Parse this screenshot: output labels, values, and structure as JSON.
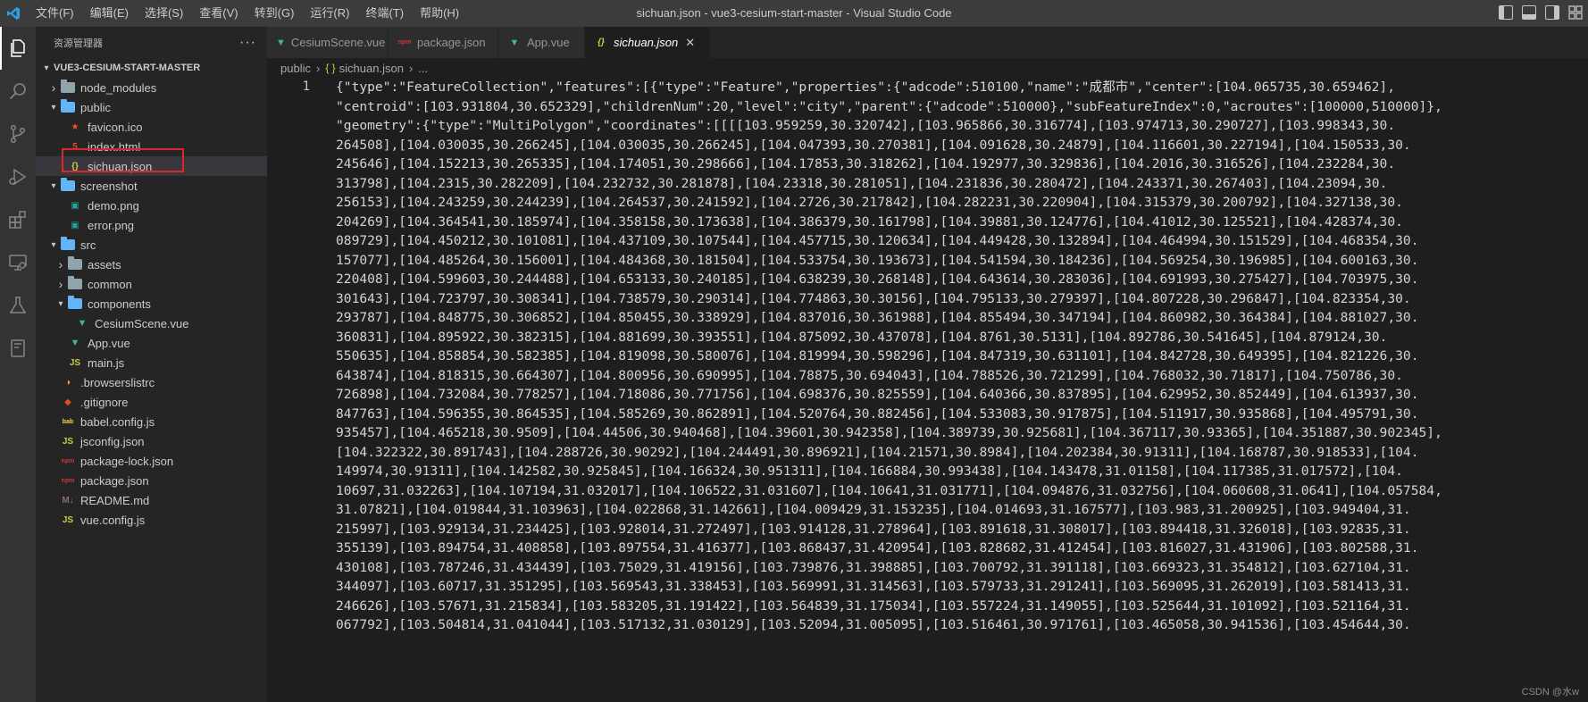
{
  "titlebar": {
    "menu": [
      "文件(F)",
      "编辑(E)",
      "选择(S)",
      "查看(V)",
      "转到(G)",
      "运行(R)",
      "终端(T)",
      "帮助(H)"
    ],
    "title": "sichuan.json - vue3-cesium-start-master - Visual Studio Code"
  },
  "activitybar": {
    "icons": [
      "explorer-icon",
      "search-icon",
      "source-control-icon",
      "run-debug-icon",
      "extensions-icon",
      "remote-explorer-icon",
      "testing-icon",
      "notebook-icon"
    ]
  },
  "sidebar": {
    "header": "资源管理器",
    "more": "···",
    "project": "VUE3-CESIUM-START-MASTER",
    "items": [
      {
        "label": "node_modules",
        "type": "folder",
        "indent": 0,
        "expanded": false
      },
      {
        "label": "public",
        "type": "folder-open",
        "indent": 0,
        "expanded": true
      },
      {
        "label": "favicon.ico",
        "type": "ico",
        "indent": 1
      },
      {
        "label": "index.html",
        "type": "html",
        "indent": 1
      },
      {
        "label": "sichuan.json",
        "type": "json",
        "indent": 1,
        "selected": true
      },
      {
        "label": "screenshot",
        "type": "folder-open",
        "indent": 0,
        "expanded": true
      },
      {
        "label": "demo.png",
        "type": "img",
        "indent": 1
      },
      {
        "label": "error.png",
        "type": "img",
        "indent": 1
      },
      {
        "label": "src",
        "type": "folder-open",
        "indent": 0,
        "expanded": true
      },
      {
        "label": "assets",
        "type": "folder",
        "indent": 1,
        "expanded": false
      },
      {
        "label": "common",
        "type": "folder",
        "indent": 1,
        "expanded": false
      },
      {
        "label": "components",
        "type": "folder-open",
        "indent": 1,
        "expanded": true
      },
      {
        "label": "CesiumScene.vue",
        "type": "vue",
        "indent": 2
      },
      {
        "label": "App.vue",
        "type": "vue",
        "indent": 1
      },
      {
        "label": "main.js",
        "type": "js",
        "indent": 1
      },
      {
        "label": ".browserslistrc",
        "type": "browsers",
        "indent": 0
      },
      {
        "label": ".gitignore",
        "type": "git",
        "indent": 0
      },
      {
        "label": "babel.config.js",
        "type": "babel",
        "indent": 0
      },
      {
        "label": "jsconfig.json",
        "type": "jsjson",
        "indent": 0
      },
      {
        "label": "package-lock.json",
        "type": "npm",
        "indent": 0
      },
      {
        "label": "package.json",
        "type": "npm",
        "indent": 0
      },
      {
        "label": "README.md",
        "type": "md",
        "indent": 0
      },
      {
        "label": "vue.config.js",
        "type": "js",
        "indent": 0
      }
    ]
  },
  "tabs": [
    {
      "label": "CesiumScene.vue",
      "type": "vue",
      "active": false
    },
    {
      "label": "package.json",
      "type": "npm",
      "active": false
    },
    {
      "label": "App.vue",
      "type": "vue",
      "active": false
    },
    {
      "label": "sichuan.json",
      "type": "json",
      "active": true,
      "close": "✕"
    }
  ],
  "breadcrumb": {
    "folder": "public",
    "file": "sichuan.json",
    "tail": "..."
  },
  "editor": {
    "line_number": "1",
    "lines": [
      "{\"type\":\"FeatureCollection\",\"features\":[{\"type\":\"Feature\",\"properties\":{\"adcode\":510100,\"name\":\"成都市\",\"center\":[104.065735,30.659462],",
      "\"centroid\":[103.931804,30.652329],\"childrenNum\":20,\"level\":\"city\",\"parent\":{\"adcode\":510000},\"subFeatureIndex\":0,\"acroutes\":[100000,510000]},",
      "\"geometry\":{\"type\":\"MultiPolygon\",\"coordinates\":[[[[103.959259,30.320742],[103.965866,30.316774],[103.974713,30.290727],[103.998343,30.",
      "264508],[104.030035,30.266245],[104.030035,30.266245],[104.047393,30.270381],[104.091628,30.24879],[104.116601,30.227194],[104.150533,30.",
      "245646],[104.152213,30.265335],[104.174051,30.298666],[104.17853,30.318262],[104.192977,30.329836],[104.2016,30.316526],[104.232284,30.",
      "313798],[104.2315,30.282209],[104.232732,30.281878],[104.23318,30.281051],[104.231836,30.280472],[104.243371,30.267403],[104.23094,30.",
      "256153],[104.243259,30.244239],[104.264537,30.241592],[104.2726,30.217842],[104.282231,30.220904],[104.315379,30.200792],[104.327138,30.",
      "204269],[104.364541,30.185974],[104.358158,30.173638],[104.386379,30.161798],[104.39881,30.124776],[104.41012,30.125521],[104.428374,30.",
      "089729],[104.450212,30.101081],[104.437109,30.107544],[104.457715,30.120634],[104.449428,30.132894],[104.464994,30.151529],[104.468354,30.",
      "157077],[104.485264,30.156001],[104.484368,30.181504],[104.533754,30.193673],[104.541594,30.184236],[104.569254,30.196985],[104.600163,30.",
      "220408],[104.599603,30.244488],[104.653133,30.240185],[104.638239,30.268148],[104.643614,30.283036],[104.691993,30.275427],[104.703975,30.",
      "301643],[104.723797,30.308341],[104.738579,30.290314],[104.774863,30.30156],[104.795133,30.279397],[104.807228,30.296847],[104.823354,30.",
      "293787],[104.848775,30.306852],[104.850455,30.338929],[104.837016,30.361988],[104.855494,30.347194],[104.860982,30.364384],[104.881027,30.",
      "360831],[104.895922,30.382315],[104.881699,30.393551],[104.875092,30.437078],[104.8761,30.5131],[104.892786,30.541645],[104.879124,30.",
      "550635],[104.858854,30.582385],[104.819098,30.580076],[104.819994,30.598296],[104.847319,30.631101],[104.842728,30.649395],[104.821226,30.",
      "643874],[104.818315,30.664307],[104.800956,30.690995],[104.78875,30.694043],[104.788526,30.721299],[104.768032,30.71817],[104.750786,30.",
      "726898],[104.732084,30.778257],[104.718086,30.771756],[104.698376,30.825559],[104.640366,30.837895],[104.629952,30.852449],[104.613937,30.",
      "847763],[104.596355,30.864535],[104.585269,30.862891],[104.520764,30.882456],[104.533083,30.917875],[104.511917,30.935868],[104.495791,30.",
      "935457],[104.465218,30.9509],[104.44506,30.940468],[104.39601,30.942358],[104.389739,30.925681],[104.367117,30.93365],[104.351887,30.902345],",
      "[104.322322,30.891743],[104.288726,30.90292],[104.244491,30.896921],[104.21571,30.8984],[104.202384,30.91311],[104.168787,30.918533],[104.",
      "149974,30.91311],[104.142582,30.925845],[104.166324,30.951311],[104.166884,30.993438],[104.143478,31.01158],[104.117385,31.017572],[104.",
      "10697,31.032263],[104.107194,31.032017],[104.106522,31.031607],[104.10641,31.031771],[104.094876,31.032756],[104.060608,31.0641],[104.057584,",
      "31.07821],[104.019844,31.103963],[104.022868,31.142661],[104.009429,31.153235],[104.014693,31.167577],[103.983,31.200925],[103.949404,31.",
      "215997],[103.929134,31.234425],[103.928014,31.272497],[103.914128,31.278964],[103.891618,31.308017],[103.894418,31.326018],[103.92835,31.",
      "355139],[103.894754,31.408858],[103.897554,31.416377],[103.868437,31.420954],[103.828682,31.412454],[103.816027,31.431906],[103.802588,31.",
      "430108],[103.787246,31.434439],[103.75029,31.419156],[103.739876,31.398885],[103.700792,31.391118],[103.669323,31.354812],[103.627104,31.",
      "344097],[103.60717,31.351295],[103.569543,31.338453],[103.569991,31.314563],[103.579733,31.291241],[103.569095,31.262019],[103.581413,31.",
      "246626],[103.57671,31.215834],[103.583205,31.191422],[103.564839,31.175034],[103.557224,31.149055],[103.525644,31.101092],[103.521164,31.",
      "067792],[103.504814,31.041044],[103.517132,31.030129],[103.52094,31.005095],[103.516461,30.971761],[103.465058,30.941536],[103.454644,30."
    ],
    "watermark": "CSDN @水w"
  }
}
